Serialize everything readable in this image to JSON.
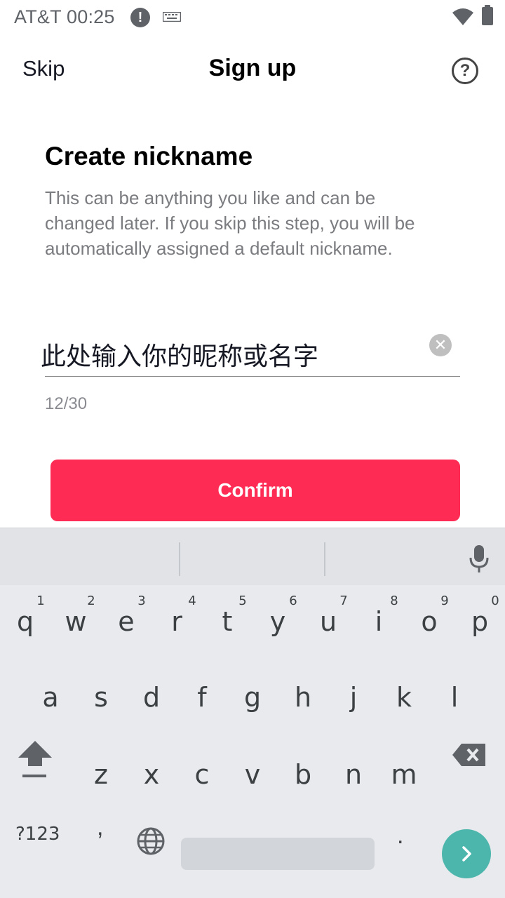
{
  "status_bar": {
    "carrier_time": "AT&T 00:25",
    "alert_icon": "!",
    "icons": [
      "alert-icon",
      "keyboard-icon",
      "wifi-icon",
      "battery-icon"
    ]
  },
  "header": {
    "skip_label": "Skip",
    "title": "Sign up",
    "help_glyph": "?"
  },
  "content": {
    "section_title": "Create nickname",
    "description": "This can be anything you like and can be changed later. If you skip this step, you will be automatically assigned a default nickname.",
    "nickname_value": "此处输入你的昵称或名字",
    "char_counter": "12/30",
    "clear_glyph": "✕",
    "confirm_label": "Confirm"
  },
  "colors": {
    "accent": "#fe2c55",
    "enter_key": "#4db6ac"
  },
  "keyboard": {
    "row1": [
      {
        "letter": "q",
        "num": "1"
      },
      {
        "letter": "w",
        "num": "2"
      },
      {
        "letter": "e",
        "num": "3"
      },
      {
        "letter": "r",
        "num": "4"
      },
      {
        "letter": "t",
        "num": "5"
      },
      {
        "letter": "y",
        "num": "6"
      },
      {
        "letter": "u",
        "num": "7"
      },
      {
        "letter": "i",
        "num": "8"
      },
      {
        "letter": "o",
        "num": "9"
      },
      {
        "letter": "p",
        "num": "0"
      }
    ],
    "row2": [
      "a",
      "s",
      "d",
      "f",
      "g",
      "h",
      "j",
      "k",
      "l"
    ],
    "row3": [
      "z",
      "x",
      "c",
      "v",
      "b",
      "n",
      "m"
    ],
    "sym_label": "?123",
    "comma_label": ",",
    "period_label": "."
  }
}
